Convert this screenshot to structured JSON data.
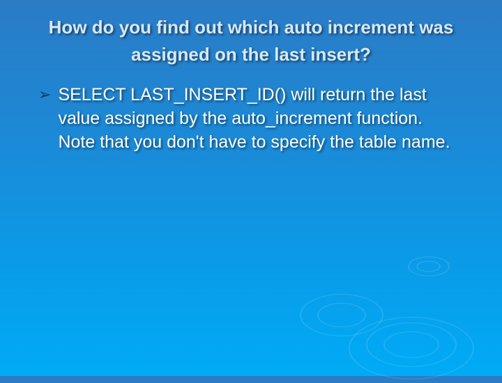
{
  "title": "How do you find out which auto increment was assigned on the last insert?",
  "bullets": [
    {
      "marker": "➢",
      "text": "SELECT LAST_INSERT_ID() will return the last value assigned by the auto_increment function. Note that you don't have to specify the table name."
    }
  ]
}
